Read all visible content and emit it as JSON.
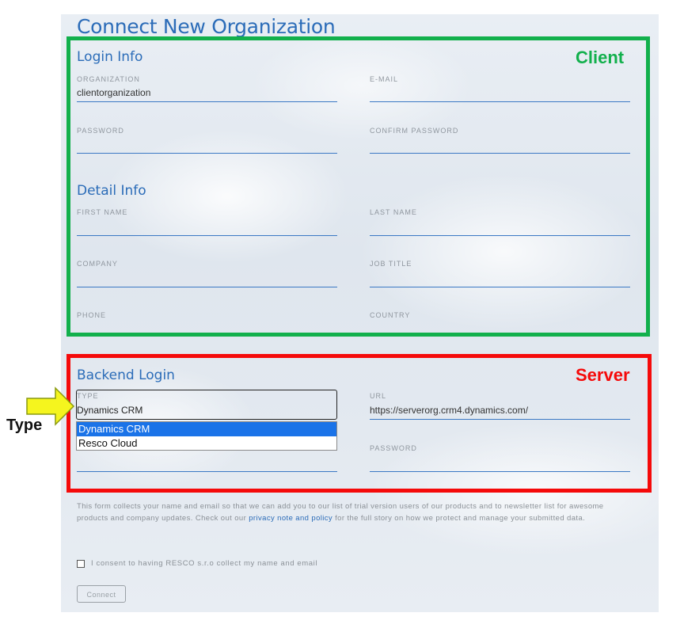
{
  "title": "Connect New Organization",
  "sections": {
    "login_info": "Login Info",
    "detail_info": "Detail Info",
    "backend_login": "Backend Login"
  },
  "fields": {
    "organization": {
      "label": "ORGANIZATION",
      "value": "clientorganization"
    },
    "email": {
      "label": "E-MAIL",
      "value": ""
    },
    "password": {
      "label": "PASSWORD",
      "value": ""
    },
    "confirm_password": {
      "label": "CONFIRM PASSWORD",
      "value": ""
    },
    "first_name": {
      "label": "FIRST NAME",
      "value": ""
    },
    "last_name": {
      "label": "LAST NAME",
      "value": ""
    },
    "company": {
      "label": "COMPANY",
      "value": ""
    },
    "job_title": {
      "label": "JOB TITLE",
      "value": ""
    },
    "phone": {
      "label": "PHONE",
      "value": ""
    },
    "country": {
      "label": "COUNTRY",
      "value": ""
    },
    "type": {
      "label": "TYPE",
      "value": "Dynamics CRM",
      "options": [
        "Dynamics CRM",
        "Resco Cloud"
      ]
    },
    "url": {
      "label": "URL",
      "value": "https://serverorg.crm4.dynamics.com/"
    },
    "backend_password": {
      "label": "PASSWORD",
      "value": ""
    }
  },
  "notice": {
    "before": "This form collects your name and email so that we can add you to our list of trial version users of our products and to newsletter list for awesome products and company updates. Check out our ",
    "link": "privacy note and policy",
    "after": " for the full story on how we protect and manage your submitted data."
  },
  "consent_label": "I consent to having RESCO s.r.o collect my name and email",
  "connect_button": "Connect",
  "annotations": {
    "client": "Client",
    "server": "Server",
    "type": "Type"
  },
  "colors": {
    "accent_blue": "#2b6cb8",
    "client_green": "#12b04c",
    "server_red": "#f50a0a",
    "arrow_yellow": "#f5f51e",
    "dropdown_selected": "#1a73e8"
  }
}
